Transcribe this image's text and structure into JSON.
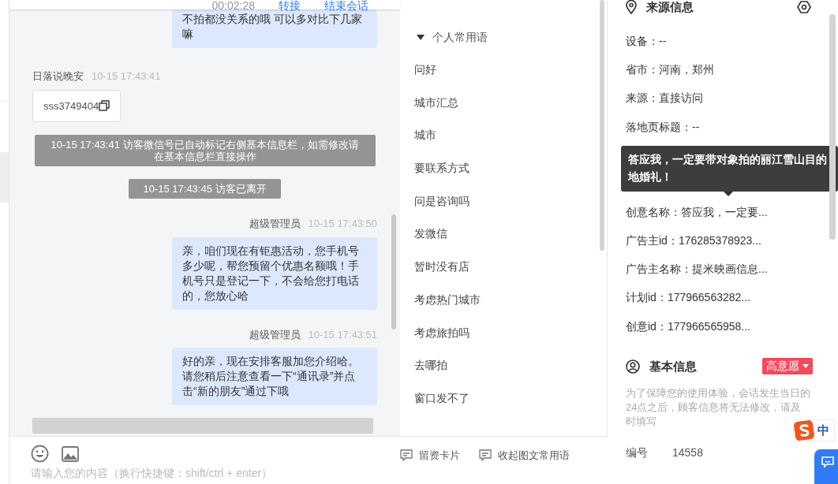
{
  "header": {
    "items": [
      "00:02:28",
      "转接",
      "结束会话"
    ]
  },
  "chat": {
    "messages": [
      {
        "kind": "agent_bubble",
        "text": "不拍都没关系的哦 可以多对比下几家嘛"
      },
      {
        "kind": "visitor_header",
        "sender": "日落说晚安",
        "time": "10-15 17:43:41"
      },
      {
        "kind": "visitor_card",
        "text": "sss3749404"
      },
      {
        "kind": "system",
        "text": "10-15 17:43:41 访客微信号已自动标记右侧基本信息栏，如需修改请在基本信息栏直接操作"
      },
      {
        "kind": "system",
        "text": "10-15 17:43:45 访客已离开"
      },
      {
        "kind": "agent_header",
        "sender": "超级管理员",
        "time": "10-15 17:43:50"
      },
      {
        "kind": "agent_bubble",
        "text": "亲，咱们现在有钜惠活动，您手机号多少呢，帮您预留个优惠名额哦！手机号只是登记一下，不会给您打电话的，您放心哈"
      },
      {
        "kind": "agent_header",
        "sender": "超级管理员",
        "time": "10-15 17:43:51"
      },
      {
        "kind": "agent_bubble",
        "text": "好的亲，现在安排客服加您介绍哈。请您稍后注意查看一下“通讯录”并点击“新的朋友”通过下哦"
      },
      {
        "kind": "system_cut"
      }
    ],
    "input": {
      "placeholder": "请输入您的内容（换行快捷键：shift/ctrl + enter）"
    }
  },
  "phrases": {
    "group": {
      "label": "个人常用语",
      "expanded": true
    },
    "items": [
      "问好",
      "城市汇总",
      "城市",
      "要联系方式",
      "问是咨询吗",
      "发微信",
      "暂时没有店",
      "考虑热门城市",
      "考虑旅拍吗",
      "去哪拍",
      "窗口发不了"
    ],
    "buttons": [
      "留资卡片",
      "收起图文常用语"
    ]
  },
  "source_info": {
    "title": "来源信息",
    "fields": [
      {
        "kind": "row",
        "text": "设备：--"
      },
      {
        "kind": "row",
        "text": "省市：河南，郑州"
      },
      {
        "kind": "row",
        "text": "来源：直接访问"
      },
      {
        "kind": "row",
        "text": "落地页标题：--"
      },
      {
        "kind": "tooltip",
        "text": "答应我，一定要带对象拍的丽江雪山目的地婚礼！"
      },
      {
        "kind": "row",
        "text": "创意名称：答应我，一定要..."
      },
      {
        "kind": "row",
        "text": "广告主id：176285378923..."
      },
      {
        "kind": "row",
        "text": "广告主名称：提米映画信息..."
      },
      {
        "kind": "row",
        "text": "计划id：177966563282..."
      },
      {
        "kind": "row",
        "text": "创意id：177966565958..."
      }
    ]
  },
  "basic_info": {
    "title": "基本信息",
    "tag": {
      "label": "高意愿",
      "color": "#f2495c"
    },
    "notice": "为了保障您的使用体验，会话发生当日的24点之后，顾客信息将无法修改，请及时填写",
    "fields": [
      {
        "label": "编号",
        "value": "14558"
      }
    ]
  },
  "ime": {
    "label": "中"
  }
}
